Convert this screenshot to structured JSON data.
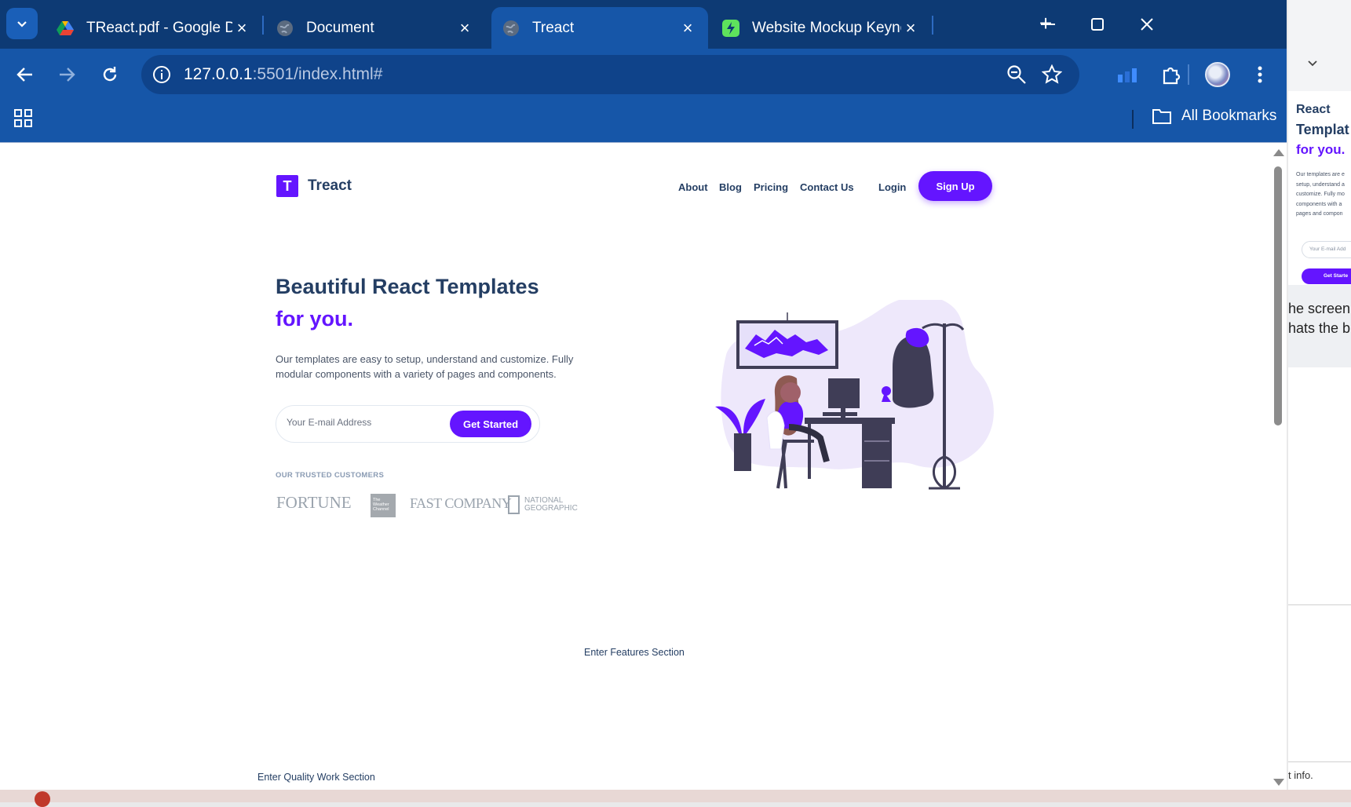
{
  "browser": {
    "tabs": [
      {
        "title": "TReact.pdf - Google Drive",
        "icon": "google-drive-icon",
        "active": false
      },
      {
        "title": "Document",
        "icon": "globe-icon",
        "active": false
      },
      {
        "title": "Treact",
        "icon": "globe-icon",
        "active": true
      },
      {
        "title": "Website Mockup Keynote",
        "icon": "app-icon",
        "active": false
      }
    ],
    "url_host": "127.0.0.1",
    "url_rest": ":5501/index.html#",
    "bookmarks_label": "All Bookmarks"
  },
  "site": {
    "logo_mark": "T",
    "logo_text": "Treact",
    "nav": {
      "about": "About",
      "blog": "Blog",
      "pricing": "Pricing",
      "contact": "Contact Us",
      "login": "Login",
      "signup": "Sign Up"
    },
    "hero": {
      "title_line1": "Beautiful React Templates",
      "title_line2": "for you.",
      "description": "Our templates are easy to setup, understand and customize. Fully modular components with a variety of pages and components.",
      "email_placeholder": "Your E-mail Address",
      "cta": "Get Started",
      "customers_heading": "OUR TRUSTED CUSTOMERS",
      "customers": [
        "FORTUNE",
        "The Weather Channel",
        "FAST COMPANY",
        "NATIONAL GEOGRAPHIC"
      ]
    },
    "features_placeholder": "Enter Features Section",
    "quality_placeholder": "Enter Quality Work Section"
  },
  "side_window": {
    "heading1": "React",
    "heading2": "Templat",
    "heading3": "for you.",
    "desc_lines": [
      "Our templates are e",
      "setup, understand a",
      "customize. Fully mo",
      "components with a",
      "pages and compon"
    ],
    "email_placeholder": "Your E-mail Add",
    "cta": "Get Starte",
    "text_line1": "he screen is",
    "text_line2": "hats the bi",
    "footer": "t info."
  },
  "colors": {
    "accent": "#6415ff",
    "heading": "#243e63",
    "browser": "#1656a8"
  }
}
